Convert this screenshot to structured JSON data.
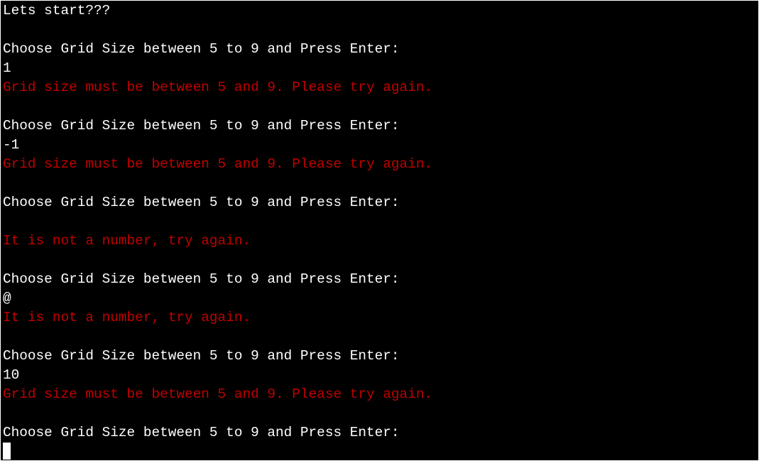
{
  "terminal": {
    "colors": {
      "background": "#000000",
      "text": "#ffffff",
      "error": "#c00000"
    },
    "lines": [
      {
        "text": "Lets start???",
        "type": "output"
      },
      {
        "text": "",
        "type": "blank"
      },
      {
        "text": "Choose Grid Size between 5 to 9 and Press Enter:",
        "type": "prompt"
      },
      {
        "text": "1",
        "type": "input"
      },
      {
        "text": "Grid size must be between 5 and 9. Please try again.",
        "type": "error"
      },
      {
        "text": "",
        "type": "blank"
      },
      {
        "text": "Choose Grid Size between 5 to 9 and Press Enter:",
        "type": "prompt"
      },
      {
        "text": "-1",
        "type": "input"
      },
      {
        "text": "Grid size must be between 5 and 9. Please try again.",
        "type": "error"
      },
      {
        "text": "",
        "type": "blank"
      },
      {
        "text": "Choose Grid Size between 5 to 9 and Press Enter:",
        "type": "prompt"
      },
      {
        "text": "",
        "type": "input"
      },
      {
        "text": "It is not a number, try again.",
        "type": "error"
      },
      {
        "text": "",
        "type": "blank"
      },
      {
        "text": "Choose Grid Size between 5 to 9 and Press Enter:",
        "type": "prompt"
      },
      {
        "text": "@",
        "type": "input"
      },
      {
        "text": "It is not a number, try again.",
        "type": "error"
      },
      {
        "text": "",
        "type": "blank"
      },
      {
        "text": "Choose Grid Size between 5 to 9 and Press Enter:",
        "type": "prompt"
      },
      {
        "text": "10",
        "type": "input"
      },
      {
        "text": "Grid size must be between 5 and 9. Please try again.",
        "type": "error"
      },
      {
        "text": "",
        "type": "blank"
      },
      {
        "text": "Choose Grid Size between 5 to 9 and Press Enter:",
        "type": "prompt"
      }
    ],
    "cursor": "block-cursor"
  }
}
